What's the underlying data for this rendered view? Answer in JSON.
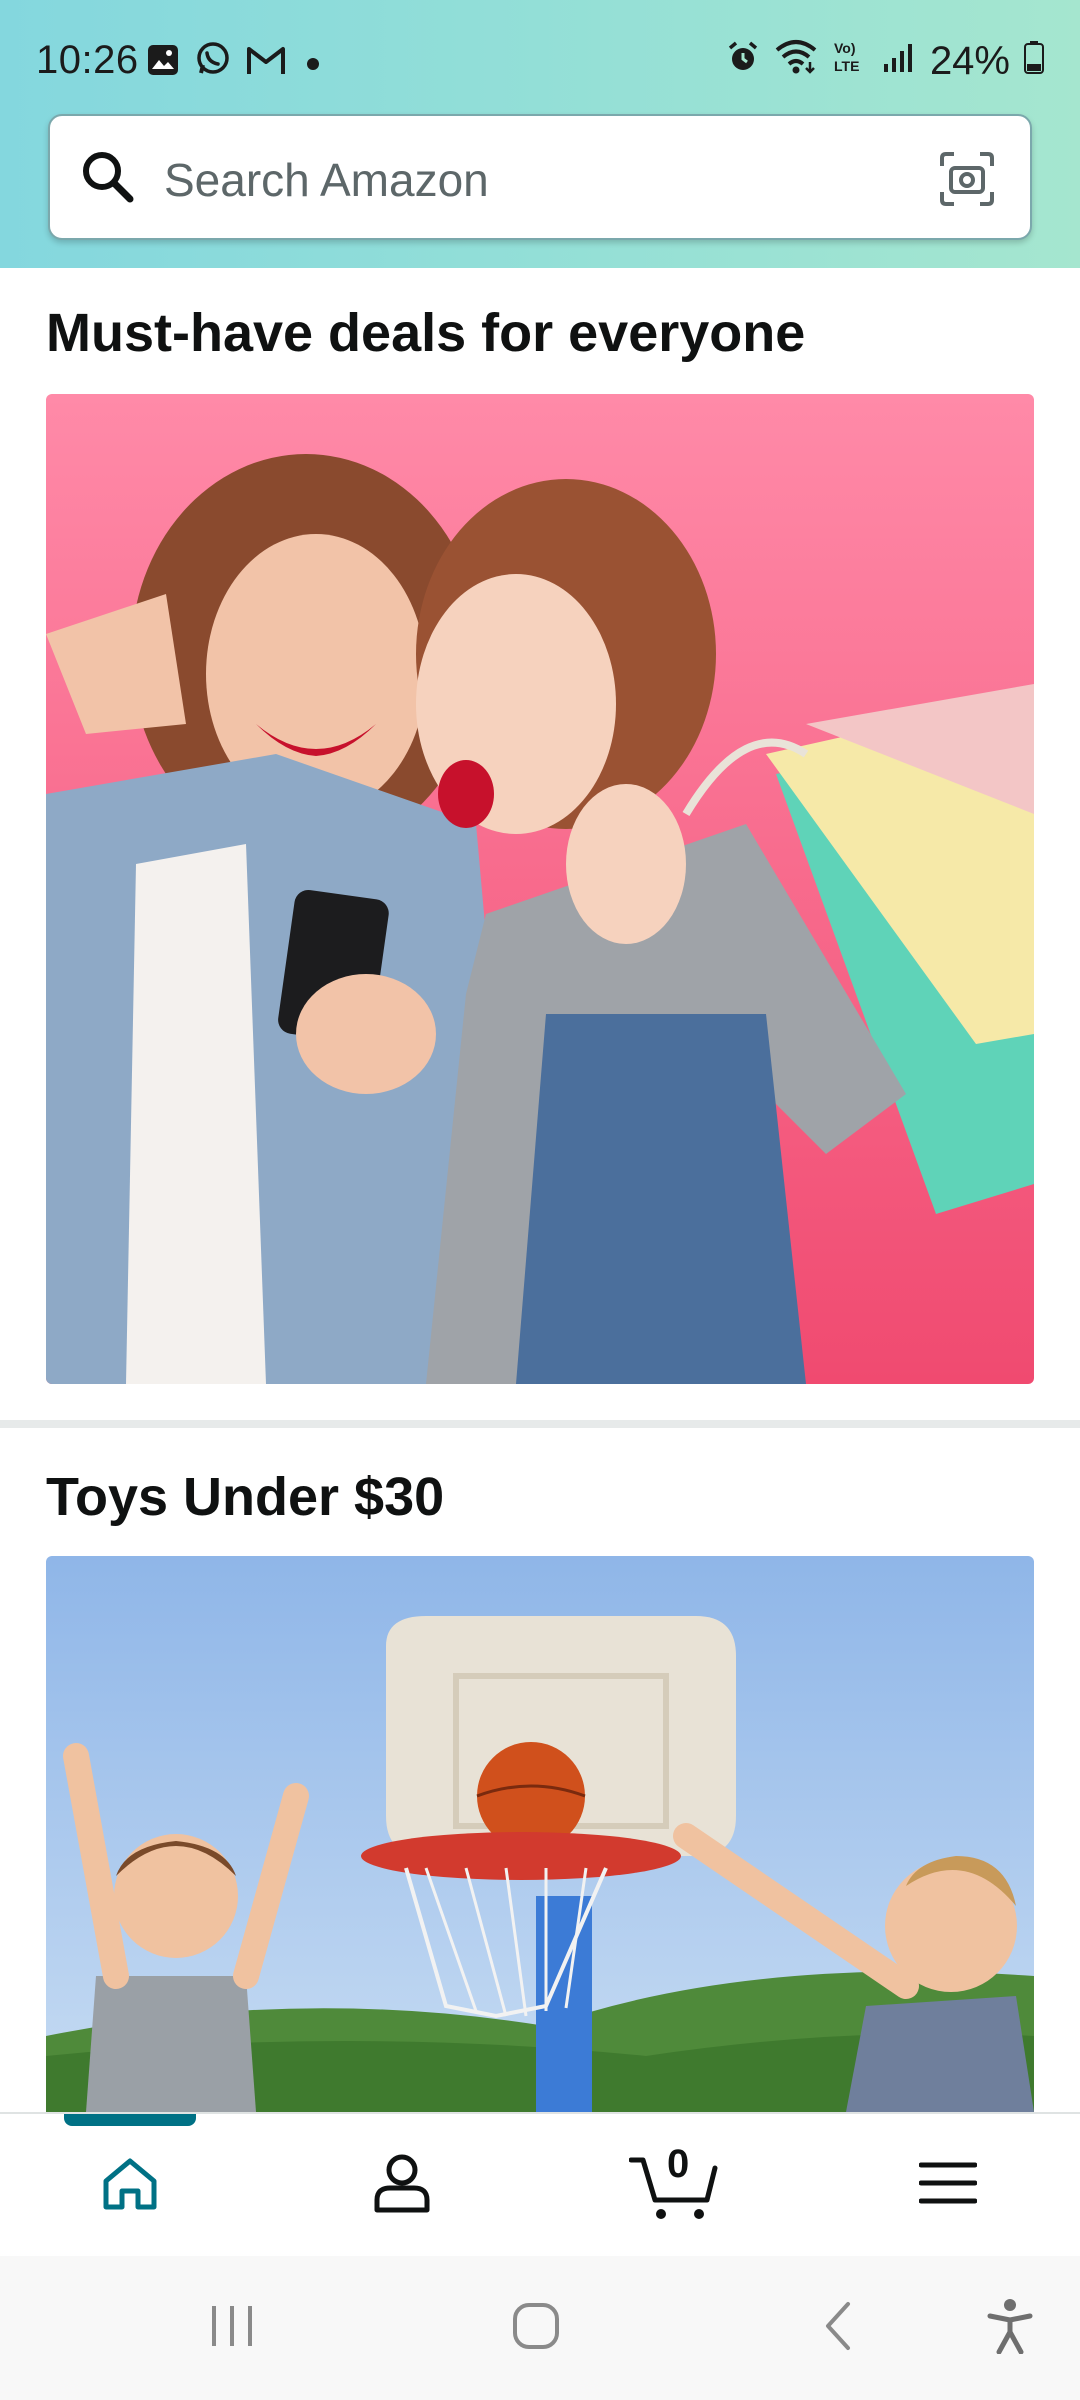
{
  "status_bar": {
    "time": "10:26",
    "notification_icons": [
      "gallery-icon",
      "whatsapp-icon",
      "gmail-icon",
      "dot-icon"
    ],
    "system_icons": [
      "alarm-icon",
      "wifi-icon",
      "volte-icon",
      "signal-icon"
    ],
    "battery_percent": "24%"
  },
  "search": {
    "placeholder": "Search Amazon",
    "value": ""
  },
  "sections": [
    {
      "title": "Must-have deals for everyone",
      "image": "two-women-shopping-photo"
    },
    {
      "title": "Toys Under $30",
      "image": "kids-basketball-hoop-photo"
    }
  ],
  "bottom_nav": {
    "items": [
      "home-icon",
      "account-icon",
      "cart-icon",
      "menu-icon"
    ],
    "active": "home",
    "cart_count": "0",
    "accent_color": "#007185"
  },
  "system_nav": {
    "items": [
      "recents-icon",
      "home-circle-icon",
      "back-icon",
      "accessibility-icon"
    ]
  }
}
